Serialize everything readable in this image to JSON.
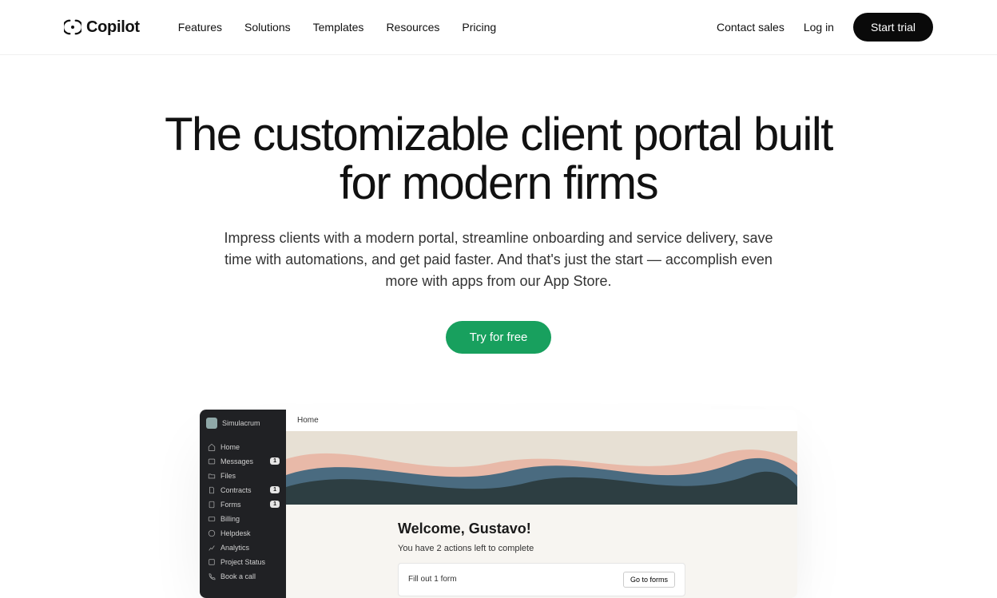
{
  "header": {
    "logo_text": "Copilot",
    "nav": [
      "Features",
      "Solutions",
      "Templates",
      "Resources",
      "Pricing"
    ],
    "contact": "Contact sales",
    "login": "Log in",
    "trial": "Start trial"
  },
  "hero": {
    "title": "The customizable client portal built for modern firms",
    "subtitle": "Impress clients with a modern portal, streamline onboarding and service delivery, save time with automations, and get paid faster. And that's just the start — accomplish even more with apps from our App Store.",
    "cta": "Try for free"
  },
  "product": {
    "brand": "Simulacrum",
    "sidebar_items": [
      {
        "label": "Home",
        "badge": ""
      },
      {
        "label": "Messages",
        "badge": "1"
      },
      {
        "label": "Files",
        "badge": ""
      },
      {
        "label": "Contracts",
        "badge": "1"
      },
      {
        "label": "Forms",
        "badge": "1"
      },
      {
        "label": "Billing",
        "badge": ""
      },
      {
        "label": "Helpdesk",
        "badge": ""
      },
      {
        "label": "Analytics",
        "badge": ""
      },
      {
        "label": "Project Status",
        "badge": ""
      },
      {
        "label": "Book a call",
        "badge": ""
      }
    ],
    "breadcrumb": "Home",
    "welcome": "Welcome, Gustavo!",
    "actions_left": "You have 2 actions left to complete",
    "action_card_text": "Fill out 1 form",
    "action_card_btn": "Go to forms"
  }
}
